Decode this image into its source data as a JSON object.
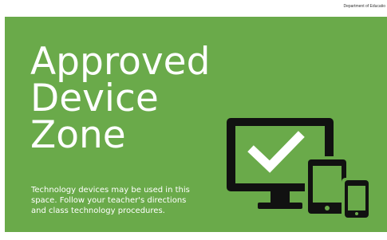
{
  "header": {
    "department": "Department of Educatio"
  },
  "sign": {
    "title_lines": [
      "Approved",
      "Device",
      "Zone"
    ],
    "body_lines": [
      "Technology devices may be used in this",
      "space. Follow your teacher's directions",
      "and class technology procedures."
    ]
  },
  "colors": {
    "panel_green": "#6aaa4a",
    "text": "#ffffff",
    "icon": "#111111"
  },
  "icons": {
    "monitor": "monitor-icon",
    "check": "check-icon",
    "tablet": "tablet-icon",
    "phone": "phone-icon"
  }
}
